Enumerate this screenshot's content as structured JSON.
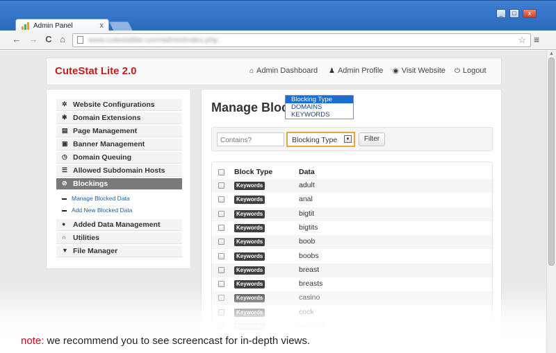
{
  "browser": {
    "tab_title": "Admin Panel",
    "tab_close": "x",
    "url": "www.cutestatlite.com/admin/index.php",
    "back": "←",
    "forward": "→",
    "reload": "C",
    "home": "⌂",
    "star": "☆",
    "menu": "≡",
    "minimize": "_",
    "maximize": "□",
    "close": "x"
  },
  "header": {
    "brand": "CuteStat Lite 2.0",
    "nav": [
      {
        "label": "Admin Dashboard",
        "icon": "home-icon",
        "glyph": "⌂"
      },
      {
        "label": "Admin Profile",
        "icon": "user-icon",
        "glyph": "♟"
      },
      {
        "label": "Visit Website",
        "icon": "globe-icon",
        "glyph": "◉"
      },
      {
        "label": "Logout",
        "icon": "power-icon",
        "glyph": "⏻"
      }
    ]
  },
  "sidebar": {
    "items": [
      {
        "label": "Website Configurations",
        "icon": "gear-icon",
        "glyph": "✲"
      },
      {
        "label": "Domain Extensions",
        "icon": "asterisk-icon",
        "glyph": "✱"
      },
      {
        "label": "Page Management",
        "icon": "file-icon",
        "glyph": "▤"
      },
      {
        "label": "Banner Management",
        "icon": "picture-icon",
        "glyph": "▣"
      },
      {
        "label": "Domain Queuing",
        "icon": "clock-icon",
        "glyph": "◷"
      },
      {
        "label": "Allowed Subdomain Hosts",
        "icon": "tasks-icon",
        "glyph": "☰"
      },
      {
        "label": "Blockings",
        "icon": "ban-icon",
        "glyph": "⊘",
        "active": true
      },
      {
        "label": "Added Data Management",
        "icon": "map-marker-icon",
        "glyph": "●"
      },
      {
        "label": "Utilities",
        "icon": "magnet-icon",
        "glyph": "∩"
      },
      {
        "label": "File Manager",
        "icon": "filter-icon",
        "glyph": "▼"
      }
    ],
    "subitems": [
      {
        "label": "Manage Blocked Data"
      },
      {
        "label": "Add New Blocked Data"
      }
    ]
  },
  "main": {
    "title": "Manage Blocked Data",
    "filter": {
      "contains_placeholder": "Contains?",
      "select_value": "Blocking Type",
      "select_arrow": "▼",
      "button": "Filter",
      "options": [
        "Blocking Type",
        "DOMAINS",
        "KEYWORDS"
      ]
    },
    "table": {
      "headers": [
        "Block Type",
        "Data"
      ],
      "rows": [
        {
          "type": "Keywords",
          "data": "adult"
        },
        {
          "type": "Keywords",
          "data": "anal"
        },
        {
          "type": "Keywords",
          "data": "bigtit"
        },
        {
          "type": "Keywords",
          "data": "bigtits"
        },
        {
          "type": "Keywords",
          "data": "boob"
        },
        {
          "type": "Keywords",
          "data": "boobs"
        },
        {
          "type": "Keywords",
          "data": "breast"
        },
        {
          "type": "Keywords",
          "data": "breasts"
        },
        {
          "type": "Keywords",
          "data": "casino"
        },
        {
          "type": "Keywords",
          "data": "cock"
        },
        {
          "type": "Keywords",
          "data": "condom"
        }
      ]
    }
  },
  "note": {
    "label": "note:",
    "text": "we recommend you to see screencast for in-depth views."
  },
  "colors": {
    "brand": "#c41c1c",
    "note_label": "#d6001c",
    "active_item": "#7a7a7a",
    "badge": "#3f3f3f",
    "link": "#1d5fa0"
  }
}
